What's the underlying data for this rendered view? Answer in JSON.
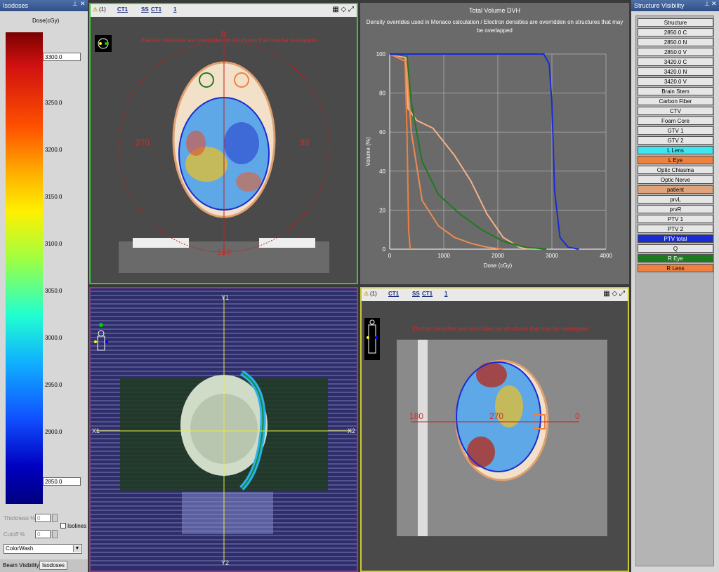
{
  "isodoses": {
    "title": "Isodoses",
    "scale_label": "Dose(cGy)",
    "upper_value": "3300.0",
    "lower_value": "2850.0",
    "ticks": [
      "3250.0",
      "3200.0",
      "3150.0",
      "3100.0",
      "3050.0",
      "3000.0",
      "2950.0",
      "2900.0"
    ],
    "thickness_label": "Thickness %",
    "thickness_value": "0",
    "cutoff_label": "Cutoff %",
    "cutoff_value": "0",
    "isolines_label": "Isolines",
    "mode_value": "ColorWash",
    "tabs": [
      "Beam Visibility",
      "Isodoses"
    ]
  },
  "toolbar": {
    "index": "(1)",
    "ct1": "CT1",
    "ss": "SS",
    "ssct": "CT1",
    "plan": "1"
  },
  "axial": {
    "warning": "Electron densities are overridden on structures that may be overlapped",
    "angle_top": "0",
    "angle_left": "270",
    "angle_right": "90",
    "angle_bottom": "180"
  },
  "coronal": {
    "label_y1": "Y1",
    "label_y2": "Y2",
    "label_x1": "X1",
    "label_x2": "X2"
  },
  "sagittal": {
    "warning": "Electron densities are overridden on structures that may be overlapped",
    "angle_left": "180",
    "angle_center": "270",
    "angle_right": "0"
  },
  "dvh": {
    "title": "Total Volume DVH",
    "subtitle": "Density overrides used in Monaco calculation / Electron densities are overridden on structures that may be overlapped"
  },
  "chart_data": {
    "type": "line",
    "xlabel": "Dose (cGy)",
    "ylabel": "Volume (%)",
    "xlim": [
      0,
      4000
    ],
    "ylim": [
      0,
      100
    ],
    "xticks": [
      0,
      1000,
      2000,
      3000,
      4000
    ],
    "yticks": [
      0,
      20,
      40,
      60,
      80,
      100
    ],
    "grid": true,
    "series": [
      {
        "color": "#f08040",
        "x": [
          0,
          280,
          320,
          350,
          380
        ],
        "y": [
          100,
          100,
          60,
          10,
          0
        ]
      },
      {
        "color": "#f7b08a",
        "x": [
          0,
          300,
          340,
          500,
          800,
          1200,
          1500,
          1800,
          2100,
          2400,
          2600
        ],
        "y": [
          100,
          98,
          72,
          66,
          62,
          48,
          35,
          18,
          6,
          1,
          0
        ]
      },
      {
        "color": "#ef8a50",
        "x": [
          0,
          310,
          400,
          600,
          900,
          1200,
          1500,
          1800,
          2100
        ],
        "y": [
          100,
          96,
          60,
          25,
          12,
          6,
          3,
          1,
          0
        ]
      },
      {
        "color": "#1e7a1e",
        "x": [
          0,
          320,
          400,
          600,
          900,
          1300,
          1700,
          2100,
          2500,
          2900
        ],
        "y": [
          100,
          99,
          75,
          45,
          28,
          18,
          10,
          4,
          1,
          0
        ]
      },
      {
        "color": "#1a2bd4",
        "x": [
          0,
          330,
          2850,
          2950,
          3000,
          3050,
          3150,
          3300,
          3500
        ],
        "y": [
          100,
          100,
          100,
          95,
          75,
          30,
          6,
          1,
          0
        ]
      }
    ]
  },
  "structures": {
    "title": "Structure Visibility",
    "header": "Structure",
    "items": [
      {
        "name": "2850.0 C",
        "color": "#e6e6e6"
      },
      {
        "name": "2850.0 N",
        "color": "#e6e6e6"
      },
      {
        "name": "2850.0 V",
        "color": "#e6e6e6"
      },
      {
        "name": "3420.0 C",
        "color": "#e6e6e6"
      },
      {
        "name": "3420.0 N",
        "color": "#e6e6e6"
      },
      {
        "name": "3420.0 V",
        "color": "#e6e6e6"
      },
      {
        "name": "Brain Stem",
        "color": "#e6e6e6"
      },
      {
        "name": "Carbon Fiber",
        "color": "#e6e6e6"
      },
      {
        "name": "CTV",
        "color": "#e6e6e6"
      },
      {
        "name": "Foam Core",
        "color": "#e6e6e6"
      },
      {
        "name": "GTV 1",
        "color": "#e6e6e6"
      },
      {
        "name": "GTV 2",
        "color": "#e6e6e6"
      },
      {
        "name": "L Lens",
        "color": "#3ee6f0"
      },
      {
        "name": "L Eye",
        "color": "#f08040"
      },
      {
        "name": "Optic Chiasma",
        "color": "#e6e6e6"
      },
      {
        "name": "Optic Nerve",
        "color": "#e6e6e6"
      },
      {
        "name": "patient",
        "color": "#e0a47c"
      },
      {
        "name": "prvL",
        "color": "#e6e6e6"
      },
      {
        "name": "prvR",
        "color": "#e6e6e6"
      },
      {
        "name": "PTV 1",
        "color": "#e6e6e6"
      },
      {
        "name": "PTV 2",
        "color": "#e6e6e6"
      },
      {
        "name": "PTV total",
        "color": "#1a2bd4"
      },
      {
        "name": "Q",
        "color": "#e6e6e6"
      },
      {
        "name": "R Eye",
        "color": "#1e7a1e"
      },
      {
        "name": "R Lens",
        "color": "#f08040"
      }
    ]
  }
}
